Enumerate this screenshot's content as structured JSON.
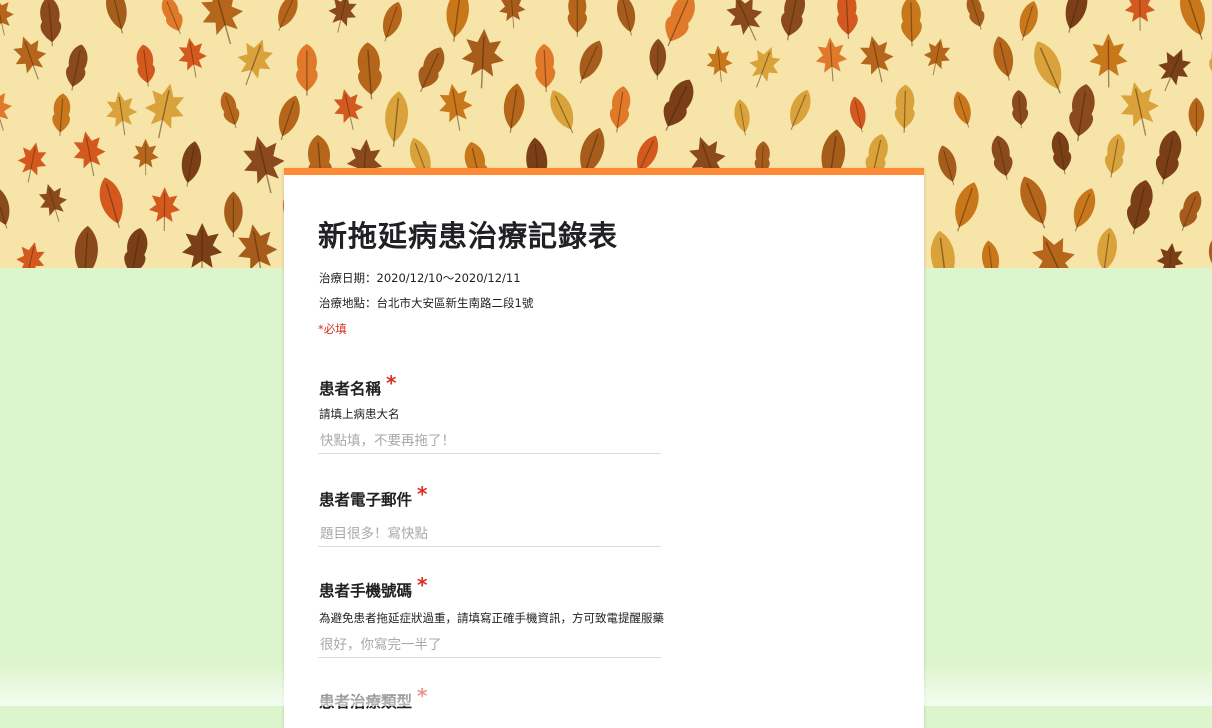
{
  "form": {
    "title": "新拖延病患治療記錄表",
    "description": [
      "治療日期：2020/12/10～2020/12/11",
      "治療地點：台北市大安區新生南路二段1號"
    ],
    "required_note": "*必填",
    "accent_color": "#ff8a35",
    "background_color": "#dcf5cc",
    "header_image": "autumn-leaves-pattern"
  },
  "questions": [
    {
      "title": "患者名稱",
      "required_mark": "*",
      "description": "請填上病患大名",
      "placeholder": "快點填，不要再拖了！",
      "value": ""
    },
    {
      "title": "患者電子郵件",
      "required_mark": "*",
      "placeholder": "題目很多！寫快點",
      "value": ""
    },
    {
      "title": "患者手機號碼",
      "required_mark": "*",
      "description": "為避免患者拖延症狀過重，請填寫正確手機資訊，方可致電提醒服藥",
      "placeholder": "很好，你寫完一半了",
      "value": ""
    },
    {
      "title": "患者治療類型",
      "required_mark": "*"
    }
  ]
}
